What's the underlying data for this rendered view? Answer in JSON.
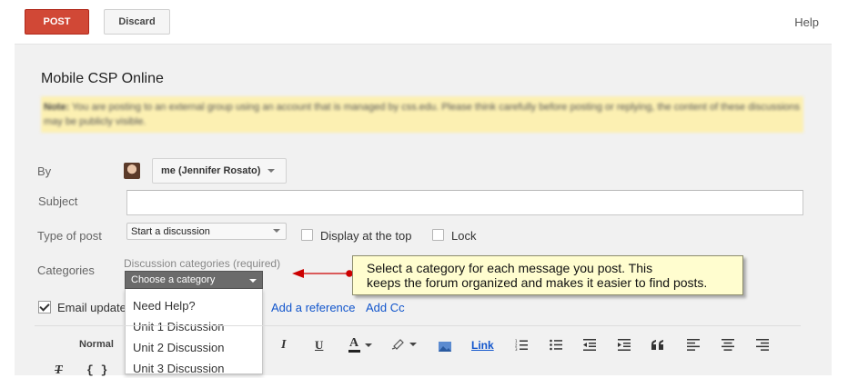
{
  "toolbar": {
    "post_label": "POST",
    "discard_label": "Discard",
    "help_label": "Help"
  },
  "group": {
    "title": "Mobile CSP Online"
  },
  "note": {
    "label": "Note:",
    "text": "You are posting to an external group using an account that is managed by css.edu. Please think carefully before posting or replying, the content of these discussions may be publicly visible."
  },
  "form": {
    "by_label": "By",
    "by_value": "me (Jennifer Rosato)",
    "subject_label": "Subject",
    "subject_value": "",
    "type_label": "Type of post",
    "type_value": "Start a discussion",
    "display_top_label": "Display at the top",
    "lock_label": "Lock",
    "categories_label": "Categories",
    "categories_hint": "Discussion categories (required)",
    "category_placeholder": "Choose a category",
    "category_options": [
      "Need Help?",
      "Unit 1 Discussion",
      "Unit 2 Discussion",
      "Unit 3 Discussion"
    ],
    "email_label": "Email update",
    "add_reference": "Add a reference",
    "add_cc": "Add Cc"
  },
  "editor": {
    "style_label": "Normal",
    "link_label": "Link",
    "italic": "I",
    "underline": "U",
    "font_color": "A",
    "code": "{ }",
    "clear_format": "T"
  },
  "callout": {
    "line1": "Select a category for each message you post. This",
    "line2": "keeps the forum organized and makes it easier to find posts."
  },
  "colors": {
    "post_button": "#d14836",
    "note_background": "#fcf0b2",
    "link": "#1155cc",
    "callout_arrow": "#cc0000"
  }
}
